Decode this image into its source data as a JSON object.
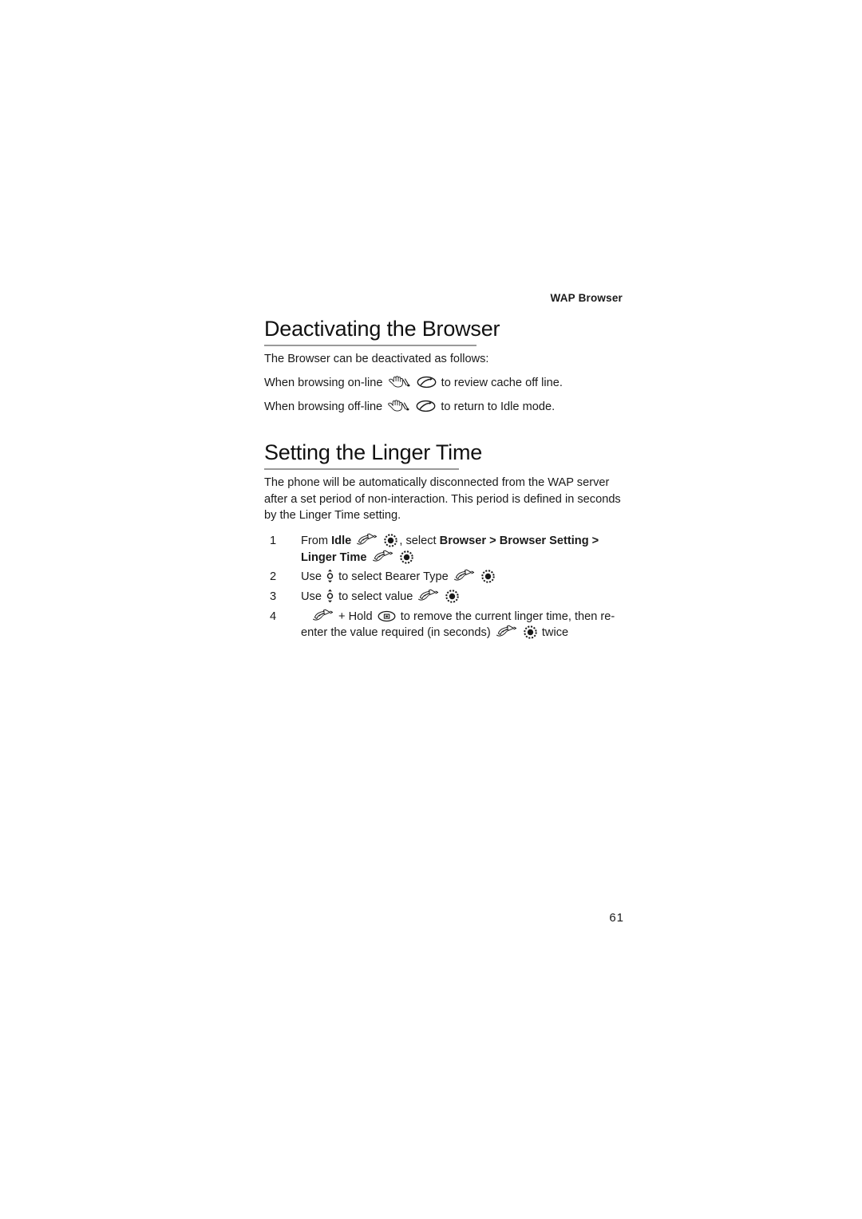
{
  "header": {
    "running_head": "WAP Browser"
  },
  "sections": [
    {
      "title": "Deactivating the Browser",
      "intro": "The Browser can be deactivated as follows:",
      "lines": [
        {
          "prefix": "When browsing on-line",
          "icons": [
            "hand-press-icon",
            "end-call-key-icon"
          ],
          "suffix": "to review cache off line."
        },
        {
          "prefix": "When browsing off-line",
          "icons": [
            "hand-press-icon",
            "end-call-key-icon"
          ],
          "suffix": "to return to Idle mode."
        }
      ]
    },
    {
      "title": "Setting the Linger Time",
      "paragraph": "The phone will be automatically disconnected from the WAP server after a set period of non-interaction. This period is defined in seconds by the Linger Time setting.",
      "steps": [
        {
          "number": "1",
          "part_a": "From ",
          "bold_a": "Idle",
          "part_b": ", select ",
          "bold_b": "Browser",
          "sep_1": " > ",
          "bold_c": "Browser Setting",
          "sep_2": " > ",
          "bold_d": "Linger Time"
        },
        {
          "number": "2",
          "part_a": "Use ",
          "part_b": " to select Bearer Type "
        },
        {
          "number": "3",
          "part_a": "Use ",
          "part_b": " to select value "
        },
        {
          "number": "4",
          "part_a": " + Hold ",
          "part_b": " to remove the current linger time, then re-enter the value required (in seconds) ",
          "part_c": " twice"
        }
      ]
    }
  ],
  "footer": {
    "page_number": "61"
  },
  "colors": {
    "text": "#1a1a1a",
    "rule": "#9a9a9a",
    "background": "#ffffff"
  }
}
